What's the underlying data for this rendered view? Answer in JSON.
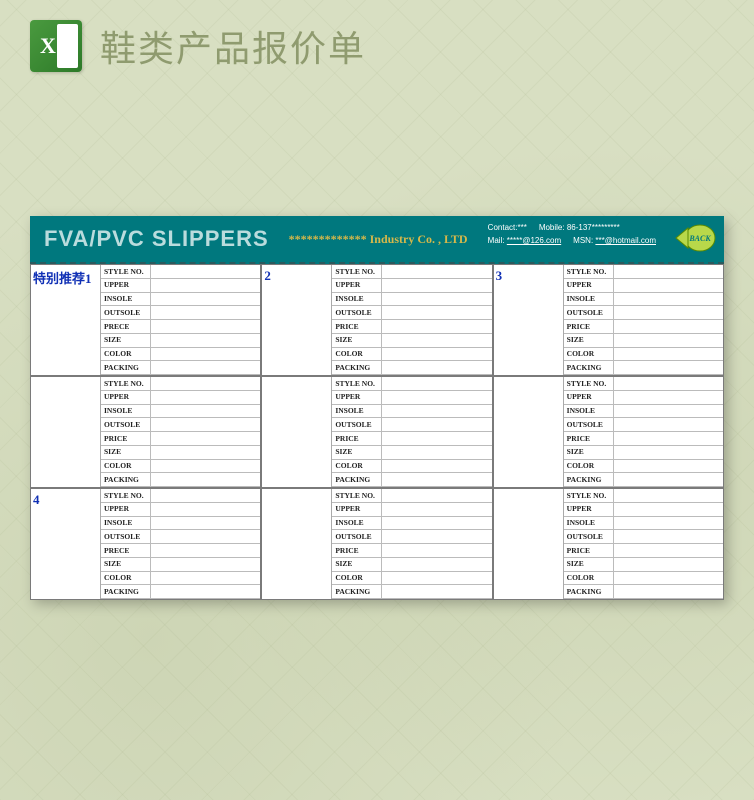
{
  "header": {
    "title": "鞋类产品报价单"
  },
  "banner": {
    "title": "FVA/PVC SLIPPERS",
    "company": "************* Industry Co. , LTD",
    "contact_label": "Contact:***",
    "mobile_label": "Mobile:",
    "mobile_value": "86-137*********",
    "mail_label": "Mail:",
    "mail_value": "*****@126.com",
    "msn_label": "MSN:",
    "msn_value": "***@hotmail.com",
    "back_label": "BACK"
  },
  "fields": [
    "STYLE NO.",
    "UPPER",
    "INSOLE",
    "OUTSOLE",
    "PRECE",
    "SIZE",
    "COLOR",
    "PACKING"
  ],
  "fields_alt": [
    "STYLE NO.",
    "UPPER",
    "INSOLE",
    "OUTSOLE",
    "PRICE",
    "SIZE",
    "COLOR",
    "PACKING"
  ],
  "cells": [
    {
      "label": "特别推荐1",
      "fieldset": "fields"
    },
    {
      "label": "2",
      "fieldset": "fields_alt"
    },
    {
      "label": "3",
      "fieldset": "fields_alt"
    },
    {
      "label": "",
      "fieldset": "fields_alt"
    },
    {
      "label": "",
      "fieldset": "fields_alt"
    },
    {
      "label": "",
      "fieldset": "fields_alt"
    },
    {
      "label": "4",
      "fieldset": "fields"
    },
    {
      "label": "",
      "fieldset": "fields_alt"
    },
    {
      "label": "",
      "fieldset": "fields_alt"
    }
  ]
}
